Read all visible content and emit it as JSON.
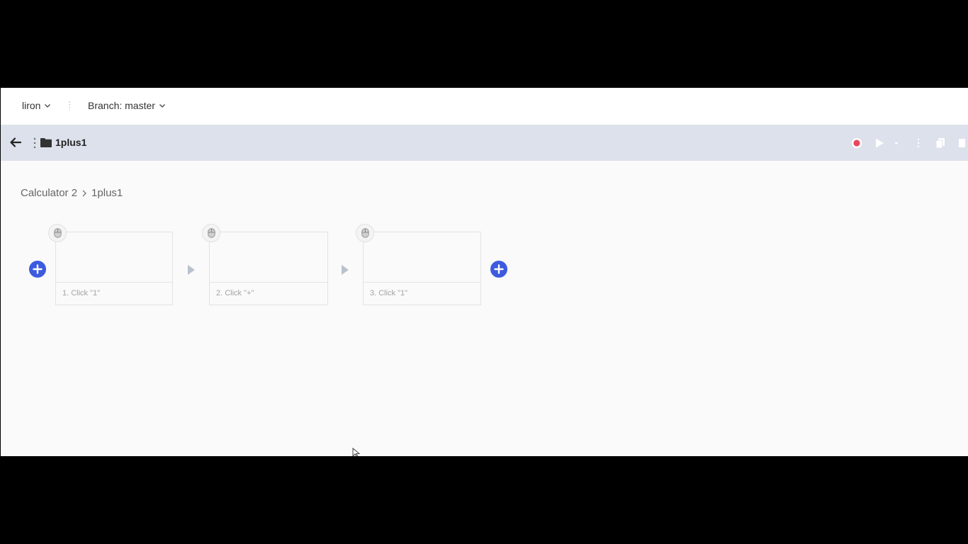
{
  "topbar": {
    "user": "liron",
    "branch": "Branch: master"
  },
  "toolbar": {
    "test_name": "1plus1"
  },
  "breadcrumb": {
    "items": [
      "Calculator 2",
      "1plus1"
    ]
  },
  "steps": [
    {
      "label": "1. Click \"1\"",
      "icon": "mouse-icon"
    },
    {
      "label": "2. Click \"+\"",
      "icon": "mouse-icon"
    },
    {
      "label": "3. Click \"1\"",
      "icon": "mouse-icon"
    }
  ],
  "colors": {
    "accent": "#3d5bdf",
    "record": "#e8485f",
    "toolbar_bg": "#dde1ec"
  }
}
